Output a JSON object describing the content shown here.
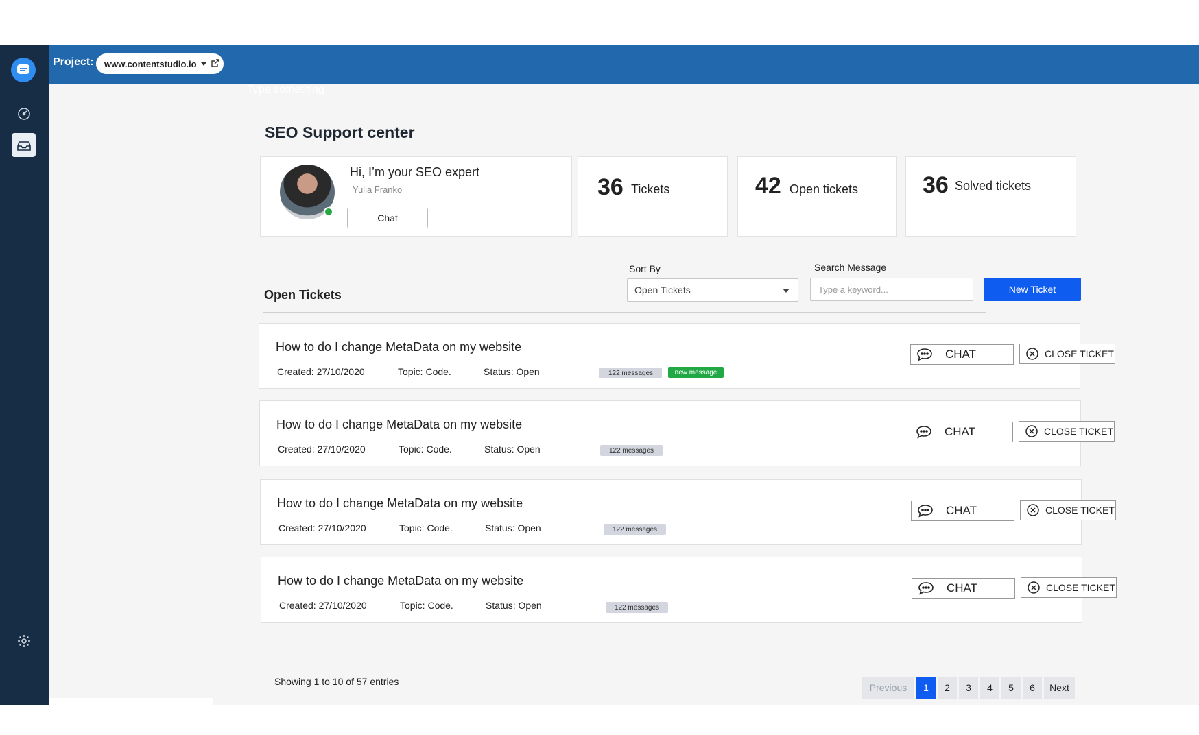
{
  "header": {
    "project_label": "Project:",
    "project_value": "www.contentstudio.io"
  },
  "sidebar": {
    "items": [
      {
        "icon": "chat-logo-icon"
      },
      {
        "icon": "dashboard-icon"
      },
      {
        "icon": "inbox-icon",
        "active": true
      },
      {
        "icon": "gear-icon"
      }
    ]
  },
  "search_hint": "Type something",
  "page_title": "SEO Support center",
  "expert": {
    "greeting": "Hi, I’m your SEO expert",
    "name": "Yulia Franko",
    "chat_label": "Chat",
    "status": "online"
  },
  "stats": [
    {
      "number": "36",
      "label": "Tickets"
    },
    {
      "number": "42",
      "label": "Open tickets"
    },
    {
      "number": "36",
      "label": "Solved tickets"
    }
  ],
  "list": {
    "title": "Open Tickets",
    "sort_label": "Sort By",
    "sort_value": "Open Tickets",
    "search_label": "Search Message",
    "search_placeholder": "Type a keyword...",
    "new_ticket_label": "New Ticket"
  },
  "tickets": [
    {
      "title": "How to do I change MetaData on my website",
      "created": "Created: 27/10/2020",
      "topic": "Topic: Code.",
      "status": "Status: Open",
      "messages": "122 messages",
      "new_badge": "new message",
      "chat_label": "CHAT",
      "close_label": "CLOSE TICKET"
    },
    {
      "title": "How to do I change MetaData on my website",
      "created": "Created: 27/10/2020",
      "topic": "Topic: Code.",
      "status": "Status: Open",
      "messages": "122 messages",
      "chat_label": "CHAT",
      "close_label": "CLOSE TICKET"
    },
    {
      "title": "How to do I change MetaData on my website",
      "created": "Created: 27/10/2020",
      "topic": "Topic: Code.",
      "status": "Status: Open",
      "messages": "122 messages",
      "chat_label": "CHAT",
      "close_label": "CLOSE TICKET"
    },
    {
      "title": "How to do I change MetaData on my website",
      "created": "Created: 27/10/2020",
      "topic": "Topic: Code.",
      "status": "Status: Open",
      "messages": "122 messages",
      "chat_label": "CHAT",
      "close_label": "CLOSE TICKET"
    }
  ],
  "pagination": {
    "summary": "Showing 1 to 10 of 57 entries",
    "previous": "Previous",
    "pages": [
      "1",
      "2",
      "3",
      "4",
      "5",
      "6"
    ],
    "current": "1",
    "next": "Next"
  },
  "colors": {
    "sidebar": "#172c45",
    "topbar": "#2168ac",
    "primary": "#0f5cf0",
    "online": "#27a844",
    "new_badge": "#22a845"
  }
}
